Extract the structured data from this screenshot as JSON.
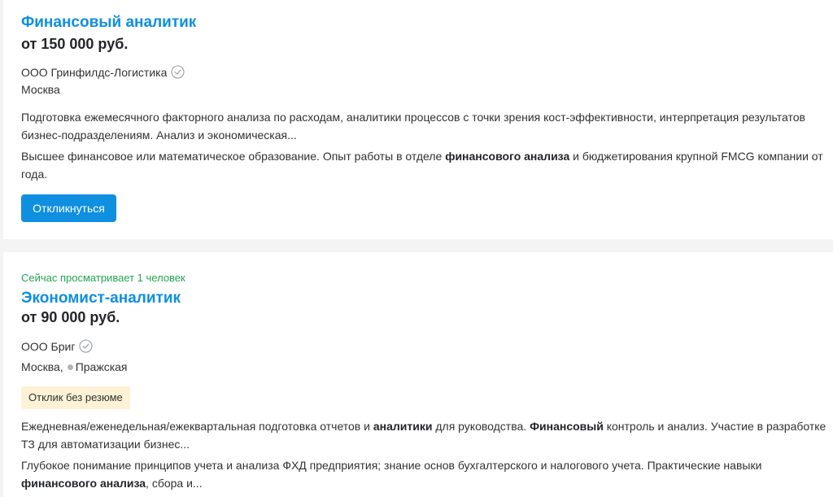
{
  "vacancies": [
    {
      "title": "Финансовый аналитик",
      "salary": "от 150 000 руб.",
      "employer": "ООО Гринфилдс-Логистика",
      "city": "Москва",
      "responsibility": "Подготовка ежемесячного факторного анализа по расходам, аналитики процессов с точки зрения кост-эффективности, интерпретация результатов бизнес-подразделениям. Анализ и экономическая...",
      "requirement_parts": [
        "Высшее финансовое или математическое образование. Опыт работы в отделе ",
        "финансового анализа",
        " и бюджетирования крупной FMCG компании от года."
      ],
      "respond_label": "Откликнуться"
    },
    {
      "viewers": "Сейчас просматривает 1 человек",
      "title": "Экономист-аналитик",
      "salary": "от 90 000 руб.",
      "employer": "ООО Бриг",
      "city": "Москва,",
      "metro": "Пражская",
      "badge": "Отклик без резюме",
      "responsibility_parts": [
        "Ежедневная/еженедельная/ежеквартальная подготовка отчетов и ",
        "аналитики",
        " для руководства. ",
        "Финансовый",
        " контроль и анализ. Участие в разработке ТЗ для автоматизации бизнес..."
      ],
      "requirement_parts": [
        "Глубокое понимание принципов учета и анализа ФХД предприятия; знание основ бухгалтерского и налогового учета. Практические навыки ",
        "финансового анализа",
        ", сбора и..."
      ]
    }
  ],
  "icons": {
    "verified": "check-circle-icon",
    "metro": "metro-dot-icon"
  },
  "colors": {
    "link": "#0e8fe0",
    "button": "#0e8fe0",
    "viewers": "#1fa652",
    "badge_bg": "#fdf2d5"
  }
}
